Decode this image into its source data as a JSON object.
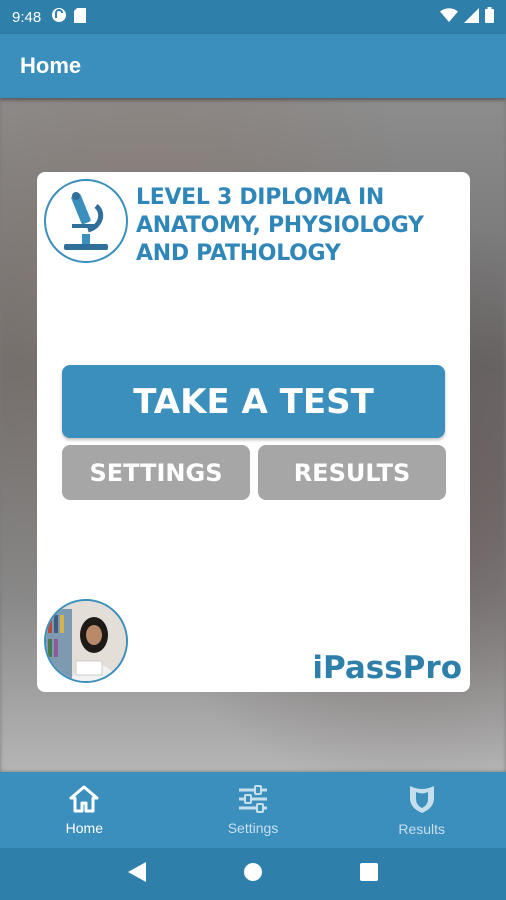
{
  "status_bar": {
    "time": "9:48",
    "icons_left": [
      "pocketcasts-icon",
      "sd-card-icon"
    ],
    "icons_right": [
      "wifi-icon",
      "signal-icon",
      "battery-icon"
    ]
  },
  "app_bar": {
    "title": "Home"
  },
  "card": {
    "title": "LEVEL 3 DIPLOMA IN ANATOMY, PHYSIOLOGY AND PATHOLOGY",
    "take_test_label": "TAKE A TEST",
    "settings_label": "SETTINGS",
    "results_label": "RESULTS",
    "brand": "iPassPro"
  },
  "bottom_nav": {
    "items": [
      {
        "label": "Home",
        "icon": "home-icon",
        "active": true
      },
      {
        "label": "Settings",
        "icon": "sliders-icon",
        "active": false
      },
      {
        "label": "Results",
        "icon": "shield-icon",
        "active": false
      }
    ]
  },
  "colors": {
    "primary": "#3a8fbd",
    "status_bar": "#2f7fab",
    "secondary_button": "#a6a6a6",
    "title_text": "#2f86b8"
  }
}
